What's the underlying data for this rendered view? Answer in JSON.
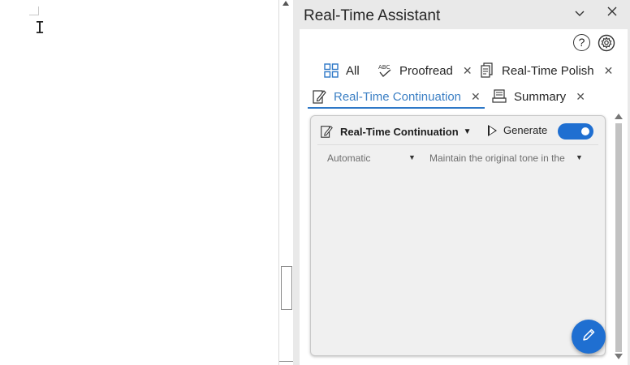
{
  "pane": {
    "title": "Real-Time Assistant"
  },
  "toolbar": {
    "help_glyph": "?"
  },
  "tabs": [
    {
      "label": "All",
      "icon": "grid-icon",
      "closable": false
    },
    {
      "label": "Proofread",
      "icon": "abc-check-icon",
      "closable": true
    },
    {
      "label": "Real-Time Polish",
      "icon": "document-icon",
      "closable": true
    },
    {
      "label": "Real-Time Continuation",
      "icon": "edit-document-icon",
      "closable": true,
      "active": true
    },
    {
      "label": "Summary",
      "icon": "summary-icon",
      "closable": true
    }
  ],
  "card": {
    "mode_label": "Real-Time Continuation",
    "generate_label": "Generate",
    "generate_enabled": true,
    "option_1": "Automatic",
    "option_2": "Maintain the original tone in the"
  },
  "colors": {
    "accent": "#1f6fd1",
    "active_tab_text": "#3b7fc4"
  }
}
